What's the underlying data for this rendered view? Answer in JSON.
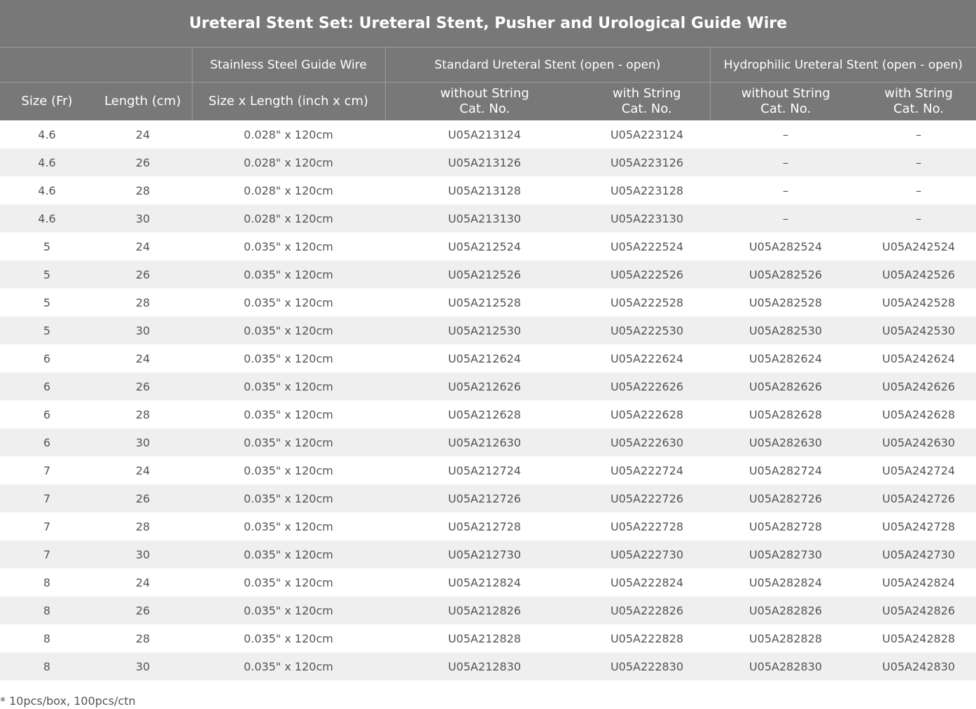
{
  "title": "Ureteral Stent Set: Ureteral Stent, Pusher and Urological Guide Wire",
  "groups": {
    "guide_wire": "Stainless Steel Guide Wire",
    "standard": "Standard Ureteral Stent (open - open)",
    "hydrophilic": "Hydrophilic Ureteral Stent (open - open)"
  },
  "columns": {
    "size": "Size (Fr)",
    "length": "Length (cm)",
    "wire": "Size x Length (inch x cm)",
    "without_string": "without String",
    "with_string": "with String",
    "cat_no": "Cat. No."
  },
  "rows": [
    [
      "4.6",
      "24",
      "0.028\" x 120cm",
      "U05A213124",
      "U05A223124",
      "–",
      "–"
    ],
    [
      "4.6",
      "26",
      "0.028\" x 120cm",
      "U05A213126",
      "U05A223126",
      "–",
      "–"
    ],
    [
      "4.6",
      "28",
      "0.028\" x 120cm",
      "U05A213128",
      "U05A223128",
      "–",
      "–"
    ],
    [
      "4.6",
      "30",
      "0.028\" x 120cm",
      "U05A213130",
      "U05A223130",
      "–",
      "–"
    ],
    [
      "5",
      "24",
      "0.035\" x 120cm",
      "U05A212524",
      "U05A222524",
      "U05A282524",
      "U05A242524"
    ],
    [
      "5",
      "26",
      "0.035\" x 120cm",
      "U05A212526",
      "U05A222526",
      "U05A282526",
      "U05A242526"
    ],
    [
      "5",
      "28",
      "0.035\" x 120cm",
      "U05A212528",
      "U05A222528",
      "U05A282528",
      "U05A242528"
    ],
    [
      "5",
      "30",
      "0.035\" x 120cm",
      "U05A212530",
      "U05A222530",
      "U05A282530",
      "U05A242530"
    ],
    [
      "6",
      "24",
      "0.035\" x 120cm",
      "U05A212624",
      "U05A222624",
      "U05A282624",
      "U05A242624"
    ],
    [
      "6",
      "26",
      "0.035\" x 120cm",
      "U05A212626",
      "U05A222626",
      "U05A282626",
      "U05A242626"
    ],
    [
      "6",
      "28",
      "0.035\" x 120cm",
      "U05A212628",
      "U05A222628",
      "U05A282628",
      "U05A242628"
    ],
    [
      "6",
      "30",
      "0.035\" x 120cm",
      "U05A212630",
      "U05A222630",
      "U05A282630",
      "U05A242630"
    ],
    [
      "7",
      "24",
      "0.035\" x 120cm",
      "U05A212724",
      "U05A222724",
      "U05A282724",
      "U05A242724"
    ],
    [
      "7",
      "26",
      "0.035\" x 120cm",
      "U05A212726",
      "U05A222726",
      "U05A282726",
      "U05A242726"
    ],
    [
      "7",
      "28",
      "0.035\" x 120cm",
      "U05A212728",
      "U05A222728",
      "U05A282728",
      "U05A242728"
    ],
    [
      "7",
      "30",
      "0.035\" x 120cm",
      "U05A212730",
      "U05A222730",
      "U05A282730",
      "U05A242730"
    ],
    [
      "8",
      "24",
      "0.035\" x 120cm",
      "U05A212824",
      "U05A222824",
      "U05A282824",
      "U05A242824"
    ],
    [
      "8",
      "26",
      "0.035\" x 120cm",
      "U05A212826",
      "U05A222826",
      "U05A282826",
      "U05A242826"
    ],
    [
      "8",
      "28",
      "0.035\" x 120cm",
      "U05A212828",
      "U05A222828",
      "U05A282828",
      "U05A242828"
    ],
    [
      "8",
      "30",
      "0.035\" x 120cm",
      "U05A212830",
      "U05A222830",
      "U05A282830",
      "U05A242830"
    ]
  ],
  "footnote": "* 10pcs/box, 100pcs/ctn"
}
